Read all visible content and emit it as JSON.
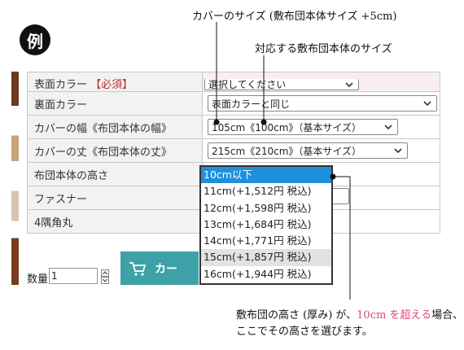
{
  "badge": "例",
  "annotations": {
    "cover_size": "カバーのサイズ (敷布団本体サイズ +5cm)",
    "futon_size": "対応する敷布団本体のサイズ",
    "note_line1_a": "敷布団の高さ (厚み) が、",
    "note_line1_pink": "10cm を超える",
    "note_line1_b": "場合、",
    "note_line2": "ここでその高さを選びます。"
  },
  "form": {
    "row0_label": "表面カラー",
    "row0_required": "【必須】",
    "row0_value": "選択してください",
    "rows": [
      {
        "label": "裏面カラー",
        "value": "表面カラーと同じ"
      },
      {
        "label": "カバーの幅《布団本体の幅》",
        "value": "105cm《100cm》（基本サイズ）"
      },
      {
        "label": "カバーの丈《布団本体の丈》",
        "value": "215cm《210cm》（基本サイズ）"
      },
      {
        "label": "布団本体の高さ",
        "value": ""
      },
      {
        "label": "ファスナー",
        "value": ""
      },
      {
        "label": "4隅角丸",
        "value": ""
      }
    ]
  },
  "dropdown": {
    "options": [
      "10cm以下",
      "11cm(+1,512円 税込)",
      "12cm(+1,598円 税込)",
      "13cm(+1,684円 税込)",
      "14cm(+1,771円 税込)",
      "15cm(+1,857円 税込)",
      "16cm(+1,944円 税込)"
    ],
    "selected_index": 0,
    "hover_index": 5
  },
  "quantity": {
    "label": "数量",
    "value": "1"
  },
  "cart_button": {
    "label": "カー"
  },
  "colors": {
    "selected": "#1e90dc",
    "cart": "#3fa1a8",
    "highlight": "#e0457b"
  }
}
